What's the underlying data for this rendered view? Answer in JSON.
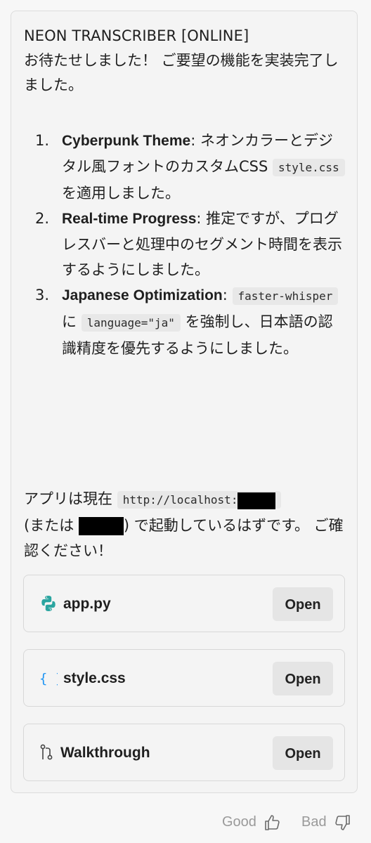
{
  "header": {
    "title": "NEON TRANSCRIBER [ONLINE]",
    "intro": "お待たせしました！ ご要望の機能を実装完了しました。"
  },
  "features": [
    {
      "num": "1.",
      "title": "Cyberpunk Theme",
      "text": ": ネオンカラーとデジタル風フォントのカスタムCSS ",
      "code": "style.css",
      "tail": " を適用しました。"
    },
    {
      "num": "2.",
      "title": "Real-time Progress",
      "text": ": 推定ですが、プログレスバーと処理中のセグメント時間を表示するようにしました。"
    },
    {
      "num": "3.",
      "title": "Japanese Optimization",
      "text": ": ",
      "code1": "faster-whisper",
      "mid": " に ",
      "code2": "language=\"ja\"",
      "tail": " を強制し、日本語の認識精度を優先するようにしました。"
    }
  ],
  "status": {
    "prefix": "アプリは現在 ",
    "url_code": "http://localhost:",
    "mid": "(または ",
    "after": ") で起動しているはずです。 ご確認ください！"
  },
  "files": [
    {
      "name": "app.py",
      "icon": "python-icon",
      "button": "Open",
      "icon_color": "#2aa5a0"
    },
    {
      "name": "style.css",
      "icon": "braces-icon",
      "button": "Open",
      "icon_color": "#2196f3"
    },
    {
      "name": "Walkthrough",
      "icon": "git-branch-icon",
      "button": "Open",
      "icon_color": "#444444"
    }
  ],
  "feedback": {
    "good_label": "Good",
    "bad_label": "Bad"
  }
}
